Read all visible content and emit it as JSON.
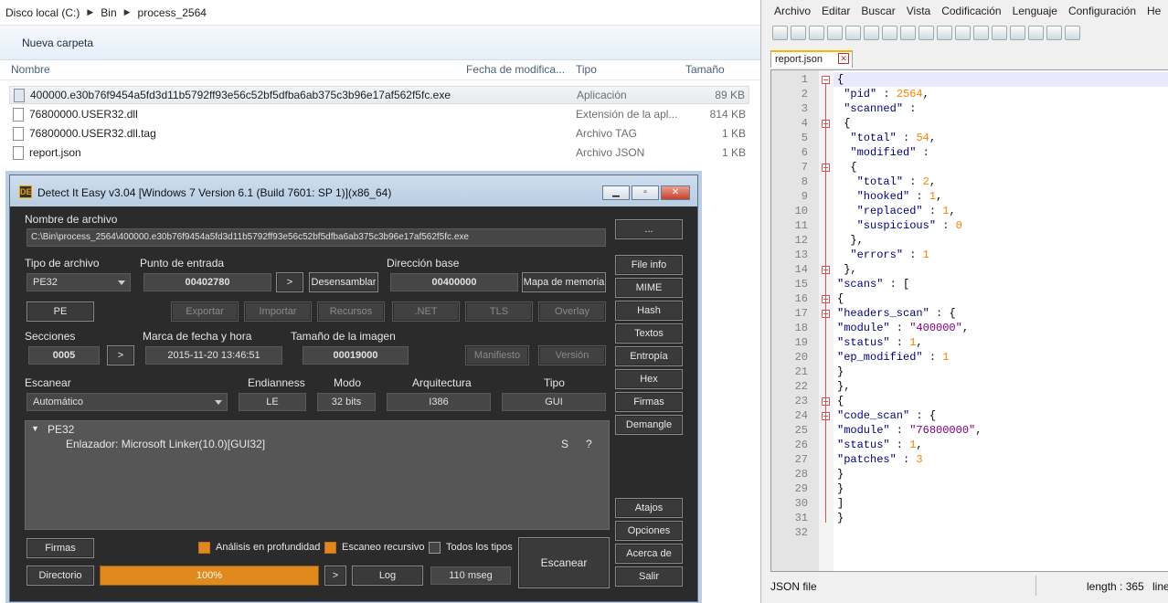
{
  "explorer": {
    "breadcrumb": [
      "Disco local (C:)",
      "Bin",
      "process_2564"
    ],
    "new_folder": "Nueva carpeta",
    "columns": {
      "name": "Nombre",
      "date": "Fecha de modifica...",
      "type": "Tipo",
      "size": "Tamaño"
    },
    "files": [
      {
        "name": "400000.e30b76f9454a5fd3d11b5792ff93e56c52bf5dfba6ab375c3b96e17af562f5fc.exe",
        "type": "Aplicación",
        "size": "89 KB"
      },
      {
        "name": "76800000.USER32.dll",
        "type": "Extensión de la apl...",
        "size": "814 KB"
      },
      {
        "name": "76800000.USER32.dll.tag",
        "type": "Archivo TAG",
        "size": "1 KB"
      },
      {
        "name": "report.json",
        "type": "Archivo JSON",
        "size": "1 KB"
      }
    ]
  },
  "npp": {
    "menu": [
      "Archivo",
      "Editar",
      "Buscar",
      "Vista",
      "Codificación",
      "Lenguaje",
      "Configuración",
      "He"
    ],
    "tab": "report.json",
    "lines": [
      "1",
      "2",
      "3",
      "4",
      "5",
      "6",
      "7",
      "8",
      "9",
      "10",
      "11",
      "12",
      "13",
      "14",
      "15",
      "16",
      "17",
      "18",
      "19",
      "20",
      "21",
      "22",
      "23",
      "24",
      "25",
      "26",
      "27",
      "28",
      "29",
      "30",
      "31",
      "32"
    ],
    "status_type": "JSON file",
    "status_length": "length : 365",
    "status_line": "line"
  },
  "die": {
    "title": "Detect It Easy v3.04 [Windows 7 Version 6.1 (Build 7601: SP 1)](x86_64)",
    "logo": "DE",
    "file_label": "Nombre de archivo",
    "file_path": "C:\\Bin\\process_2564\\400000.e30b76f9454a5fd3d11b5792ff93e56c52bf5dfba6ab375c3b96e17af562f5fc.exe",
    "browse": "...",
    "type_label": "Tipo de archivo",
    "type_value": "PE32",
    "entry_label": "Punto de entrada",
    "entry_value": "00402780",
    "gt": ">",
    "disasm": "Desensamblar",
    "base_label": "Dirección base",
    "base_value": "00400000",
    "memmap": "Mapa de memoria",
    "pe_btn": "PE",
    "export": "Exportar",
    "import": "Importar",
    "resources": "Recursos",
    "net": ".NET",
    "tls": "TLS",
    "overlay": "Overlay",
    "sections_label": "Secciones",
    "sections_value": "0005",
    "timestamp_label": "Marca de fecha y hora",
    "timestamp_value": "2015-11-20 13:46:51",
    "imgsize_label": "Tamaño de la imagen",
    "imgsize_value": "00019000",
    "manifest": "Manifiesto",
    "version": "Versión",
    "scan_label": "Escanear",
    "scan_value": "Automático",
    "endian_label": "Endianness",
    "endian_value": "LE",
    "mode_label": "Modo",
    "mode_value": "32 bits",
    "arch_label": "Arquitectura",
    "arch_value": "I386",
    "ptype_label": "Tipo",
    "ptype_value": "GUI",
    "result_root": "PE32",
    "result_item": "Enlazador: Microsoft Linker(10.0)[GUI32]",
    "result_s": "S",
    "result_q": "?",
    "right_buttons": [
      "File info",
      "MIME",
      "Hash",
      "Textos",
      "Entropía",
      "Hex",
      "Firmas",
      "Demangle"
    ],
    "atajos": "Atajos",
    "opciones": "Opciones",
    "acerca": "Acerca de",
    "salir": "Salir",
    "firmas_btn": "Firmas",
    "deep": "Análisis en profundidad",
    "recursive": "Escaneo recursivo",
    "alltypes": "Todos los tipos",
    "scan_btn": "Escanear",
    "dir_btn": "Directorio",
    "progress": "100%",
    "progress_fraction": 1.0,
    "log": "Log",
    "time": "110 mseg",
    "accent": "#e08a1e"
  }
}
